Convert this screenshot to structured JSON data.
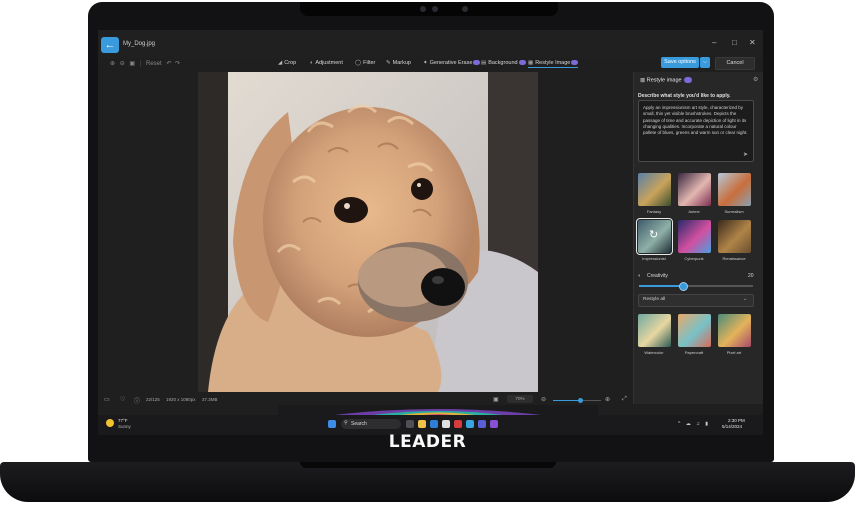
{
  "window": {
    "file_name": "My_Dog.jpg"
  },
  "toolbar": {
    "reset_label": "Reset",
    "tools": [
      {
        "label": "Crop",
        "icon": "crop-icon",
        "badge": false
      },
      {
        "label": "Adjustment",
        "icon": "adjustment-icon",
        "badge": false
      },
      {
        "label": "Filter",
        "icon": "filter-icon",
        "badge": false
      },
      {
        "label": "Markup",
        "icon": "markup-icon",
        "badge": false
      },
      {
        "label": "Generative Erase",
        "icon": "generative-erase-icon",
        "badge": true
      },
      {
        "label": "Background",
        "icon": "background-icon",
        "badge": true
      },
      {
        "label": "Restyle Image",
        "icon": "restyle-icon",
        "badge": true
      }
    ],
    "save_label": "Save options",
    "cancel_label": "Cancel"
  },
  "status": {
    "index": "22/125",
    "resolution": "1920 x 1080px",
    "size": "37.3MB",
    "zoom": "70%"
  },
  "panel": {
    "title": "Restyle image",
    "prompt_label": "Describe what style you'd like to apply.",
    "prompt_text": "Apply an impressionism art style, characterized by small, thin yet visible brushstrokes. Depicts the passage of time and accurate depiction of light in its changing qualities. Incorporate a natural colour pallete of blues, greens and warm sun or clear night.",
    "styles": [
      {
        "label": "Fantasy",
        "colors": [
          "#5a7fa8",
          "#c9a35a",
          "#3b4d2e"
        ]
      },
      {
        "label": "Anime",
        "colors": [
          "#3a2740",
          "#e2b7b0",
          "#7d2f50"
        ]
      },
      {
        "label": "Surrealism",
        "colors": [
          "#b4c8d8",
          "#c96e3c",
          "#8aa0b0"
        ]
      },
      {
        "label": "Impressionist",
        "colors": [
          "#3d5a6a",
          "#8fb0a8",
          "#1e2d34"
        ]
      },
      {
        "label": "Cyberpunk",
        "colors": [
          "#2b2a6a",
          "#d24fa0",
          "#4a9fe0"
        ]
      },
      {
        "label": "Renaissance",
        "colors": [
          "#3a2a1c",
          "#b08448",
          "#6a4e30"
        ]
      }
    ],
    "creativity_label": "Creativity",
    "creativity_value": "20",
    "creativity_fraction": 0.38,
    "scope_option": "Restyle all",
    "bottom_styles": [
      {
        "label": "Watercolor",
        "colors": [
          "#6fa8a0",
          "#e7d7a0",
          "#2e5a56"
        ]
      },
      {
        "label": "Papercraft",
        "colors": [
          "#e8a86a",
          "#78c2c8",
          "#d76a5a"
        ]
      },
      {
        "label": "Pixel art",
        "colors": [
          "#4a8a7a",
          "#e4b35a",
          "#a84a6a"
        ]
      }
    ]
  },
  "taskbar": {
    "temperature": "77°F",
    "weather": "Sunny",
    "search_label": "Search",
    "time": "2:30 PM",
    "date": "5/14/2024"
  },
  "brand": "LEADER"
}
